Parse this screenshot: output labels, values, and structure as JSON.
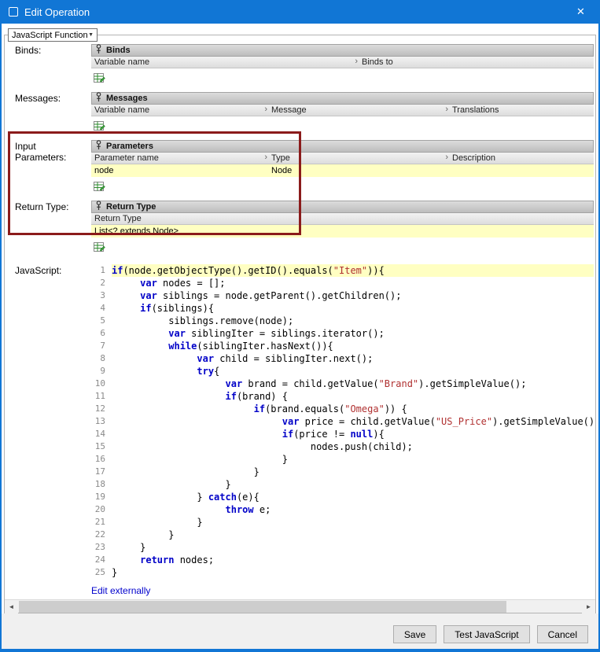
{
  "titlebar": {
    "title": "Edit Operation"
  },
  "toolbar": {
    "function_type": "JavaScript Function"
  },
  "glyphs": {
    "chevron": "›",
    "caret": "▼",
    "close": "✕",
    "scroll_left": "◄",
    "scroll_right": "►"
  },
  "binds": {
    "label": "Binds:",
    "header": "Binds",
    "col_variable": "Variable name",
    "col_binds_to": "Binds to"
  },
  "messages": {
    "label": "Messages:",
    "header": "Messages",
    "col_variable": "Variable name",
    "col_message": "Message",
    "col_translations": "Translations"
  },
  "parameters": {
    "label": "Input Parameters:",
    "header": "Parameters",
    "col_name": "Parameter name",
    "col_type": "Type",
    "col_description": "Description",
    "row": {
      "name": "node",
      "type": "Node",
      "description": ""
    }
  },
  "return_type": {
    "label": "Return Type:",
    "header": "Return Type",
    "col_return_type": "Return Type",
    "row": {
      "value": "List<? extends Node>"
    }
  },
  "javascript": {
    "label": "JavaScript:",
    "edit_externally": "Edit externally",
    "highlight_line": 1,
    "lines": [
      [
        [
          "k",
          "if"
        ],
        [
          "p",
          "(node.getObjectType().getID().equals("
        ],
        [
          "s",
          "\"Item\""
        ],
        [
          "p",
          ")){"
        ]
      ],
      [
        [
          "p",
          "     "
        ],
        [
          "k",
          "var"
        ],
        [
          "p",
          " nodes = [];"
        ]
      ],
      [
        [
          "p",
          "     "
        ],
        [
          "k",
          "var"
        ],
        [
          "p",
          " siblings = node.getParent().getChildren();"
        ]
      ],
      [
        [
          "p",
          "     "
        ],
        [
          "k",
          "if"
        ],
        [
          "p",
          "(siblings){"
        ]
      ],
      [
        [
          "p",
          "          siblings.remove(node);"
        ]
      ],
      [
        [
          "p",
          "          "
        ],
        [
          "k",
          "var"
        ],
        [
          "p",
          " siblingIter = siblings.iterator();"
        ]
      ],
      [
        [
          "p",
          "          "
        ],
        [
          "k",
          "while"
        ],
        [
          "p",
          "(siblingIter.hasNext()){"
        ]
      ],
      [
        [
          "p",
          "               "
        ],
        [
          "k",
          "var"
        ],
        [
          "p",
          " child = siblingIter.next();"
        ]
      ],
      [
        [
          "p",
          "               "
        ],
        [
          "k",
          "try"
        ],
        [
          "p",
          "{"
        ]
      ],
      [
        [
          "p",
          "                    "
        ],
        [
          "k",
          "var"
        ],
        [
          "p",
          " brand = child.getValue("
        ],
        [
          "s",
          "\"Brand\""
        ],
        [
          "p",
          ").getSimpleValue();"
        ]
      ],
      [
        [
          "p",
          "                    "
        ],
        [
          "k",
          "if"
        ],
        [
          "p",
          "(brand) {"
        ]
      ],
      [
        [
          "p",
          "                         "
        ],
        [
          "k",
          "if"
        ],
        [
          "p",
          "(brand.equals("
        ],
        [
          "s",
          "\"Omega\""
        ],
        [
          "p",
          ")) {"
        ]
      ],
      [
        [
          "p",
          "                              "
        ],
        [
          "k",
          "var"
        ],
        [
          "p",
          " price = child.getValue("
        ],
        [
          "s",
          "\"US_Price\""
        ],
        [
          "p",
          ").getSimpleValue();"
        ]
      ],
      [
        [
          "p",
          "                              "
        ],
        [
          "k",
          "if"
        ],
        [
          "p",
          "(price != "
        ],
        [
          "k",
          "null"
        ],
        [
          "p",
          "){"
        ]
      ],
      [
        [
          "p",
          "                                   nodes.push(child);"
        ]
      ],
      [
        [
          "p",
          "                              }"
        ]
      ],
      [
        [
          "p",
          "                         }"
        ]
      ],
      [
        [
          "p",
          "                    }"
        ]
      ],
      [
        [
          "p",
          "               } "
        ],
        [
          "k",
          "catch"
        ],
        [
          "p",
          "(e){"
        ]
      ],
      [
        [
          "p",
          "                    "
        ],
        [
          "k",
          "throw"
        ],
        [
          "p",
          " e;"
        ]
      ],
      [
        [
          "p",
          "               }"
        ]
      ],
      [
        [
          "p",
          "          }"
        ]
      ],
      [
        [
          "p",
          "     }"
        ]
      ],
      [
        [
          "p",
          "     "
        ],
        [
          "k",
          "return"
        ],
        [
          "p",
          " nodes;"
        ]
      ],
      [
        [
          "p",
          "}"
        ]
      ]
    ]
  },
  "footer": {
    "save": "Save",
    "test": "Test JavaScript",
    "cancel": "Cancel"
  },
  "colors": {
    "accent": "#1176d5",
    "keyword": "#0101c8",
    "string": "#b03030",
    "row_highlight": "#ffffc2",
    "annotation": "#8b1b1b",
    "link": "#0000cc"
  }
}
